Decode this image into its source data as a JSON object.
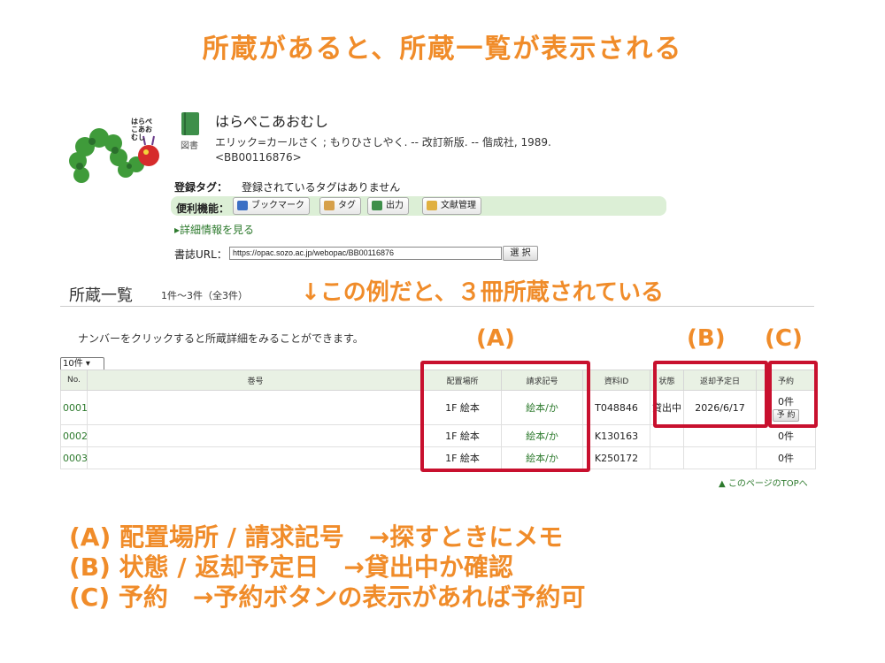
{
  "headline": "所蔵があると、所蔵一覧が表示される",
  "book": {
    "cover_text": "はらぺこあおむし",
    "kind": "図書",
    "title": "はらぺこあおむし",
    "meta_line1": "エリック=カールさく ; もりひさしやく. -- 改訂新版. -- 偕成社, 1989.",
    "meta_line2": "<BB00116876>",
    "tags_label": "登録タグ：",
    "tags_value": "登録されているタグはありません",
    "tools_label": "便利機能：",
    "tools": [
      "ブックマーク",
      "タグ",
      "出力",
      "文献管理"
    ],
    "tool_icon_colors": [
      "#3b6fc4",
      "#d6a04a",
      "#3e8f4a",
      "#e0b040"
    ],
    "detail_link": "▸詳細情報を見る",
    "url_label": "書誌URL：",
    "url_value": "https://opac.sozo.ac.jp/webopac/BB00116876",
    "select_button": "選 択"
  },
  "holdings": {
    "title": "所蔵一覧",
    "count": "1件～3件（全3件）",
    "note": "↓この例だと、３冊所蔵されている",
    "instruction": "ナンバーをクリックすると所蔵詳細をみることができます。",
    "per_page": "10件 ▾",
    "labels": {
      "a": "(A)",
      "b": "(B)",
      "c": "(C)"
    },
    "columns": [
      "No.",
      "巻号",
      "配置場所",
      "請求記号",
      "資料ID",
      "状態",
      "返却予定日",
      "予約"
    ],
    "rows": [
      {
        "no": "0001",
        "volume": "",
        "location": "1F 絵本",
        "call_number": "絵本/か",
        "id": "T048846",
        "status": "貸出中",
        "due": "2026/6/17",
        "reserve": "0件",
        "reserve_button": "予 約"
      },
      {
        "no": "0002",
        "volume": "",
        "location": "1F 絵本",
        "call_number": "絵本/か",
        "id": "K130163",
        "status": "",
        "due": "",
        "reserve": "0件"
      },
      {
        "no": "0003",
        "volume": "",
        "location": "1F 絵本",
        "call_number": "絵本/か",
        "id": "K250172",
        "status": "",
        "due": "",
        "reserve": "0件"
      }
    ],
    "top_link": "▲ このページのTOPへ"
  },
  "legend": [
    "(A) 配置場所 / 請求記号　→探すときにメモ",
    "(B) 状態 / 返却予定日　→貸出中か確認",
    "(C) 予約　→予約ボタンの表示があれば予約可"
  ],
  "colors": {
    "accent_orange": "#f08c2a",
    "highlight_red": "#c8102e",
    "link_green": "#2d7a2d",
    "toolbar_green": "#dcefd6"
  }
}
